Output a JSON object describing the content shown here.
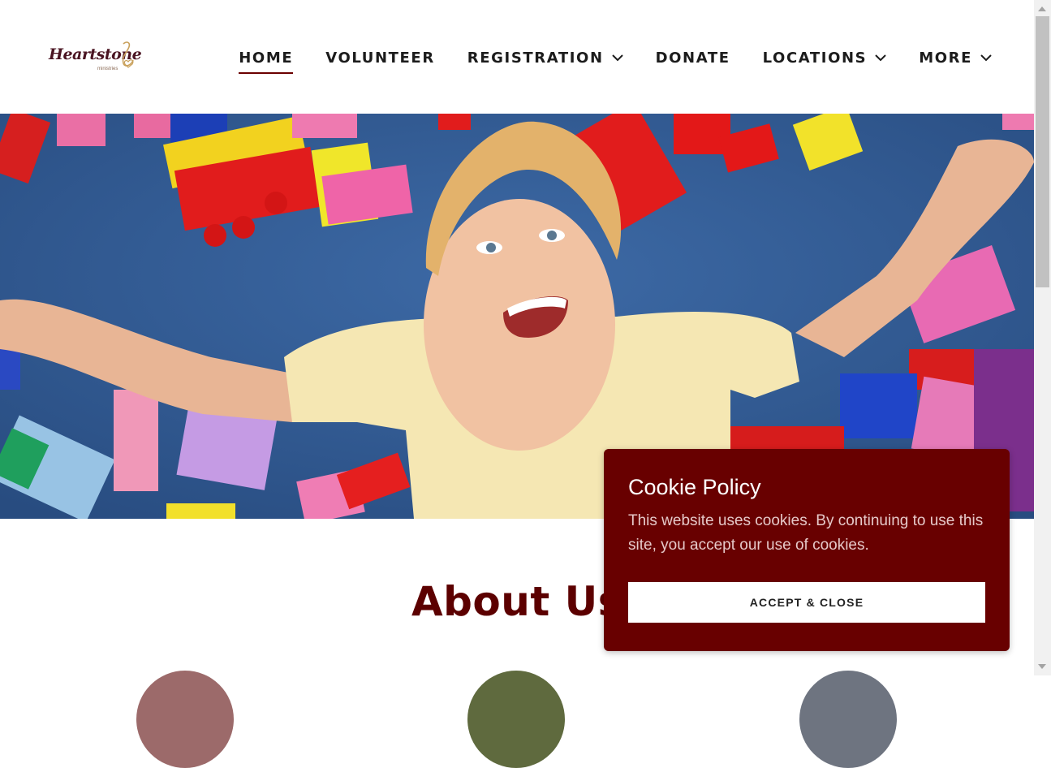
{
  "brand": {
    "logo_text": "Heartstone",
    "logo_sub": "ministries",
    "color": "#680000"
  },
  "nav": {
    "items": [
      {
        "label": "HOME",
        "active": true,
        "dropdown": false
      },
      {
        "label": "VOLUNTEER",
        "active": false,
        "dropdown": false
      },
      {
        "label": "REGISTRATION",
        "active": false,
        "dropdown": true
      },
      {
        "label": "DONATE",
        "active": false,
        "dropdown": false
      },
      {
        "label": "LOCATIONS",
        "active": false,
        "dropdown": true
      },
      {
        "label": "MORE",
        "active": false,
        "dropdown": true
      }
    ]
  },
  "hero": {
    "image": "child-playing-with-blocks-photo"
  },
  "about": {
    "title": "About Us"
  },
  "cookie": {
    "title": "Cookie Policy",
    "text": "This website uses cookies. By continuing to use this site, you accept our use of cookies.",
    "button_label": "ACCEPT & CLOSE",
    "bg_color": "#680000"
  }
}
